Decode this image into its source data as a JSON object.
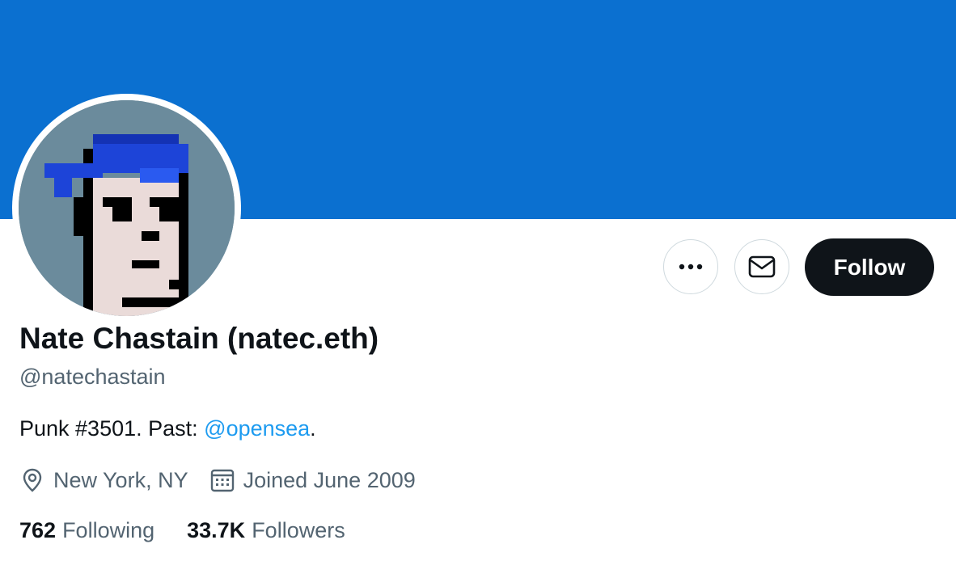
{
  "profile": {
    "display_name": "Nate Chastain (natec.eth)",
    "handle": "@natechastain",
    "bio_text": "Punk #3501. Past: ",
    "bio_mention": "@opensea",
    "bio_end": ".",
    "location": "New York, NY",
    "joined": "Joined June 2009",
    "following_count": "762",
    "following_label": "Following",
    "followers_count": "33.7K",
    "followers_label": "Followers"
  },
  "actions": {
    "follow_label": "Follow",
    "more_icon": "more-horizontal-icon",
    "message_icon": "envelope-icon"
  },
  "colors": {
    "banner": "#0b70d0",
    "link": "#1d9bf0",
    "follow_bg": "#0f1419",
    "secondary_text": "#536471"
  }
}
